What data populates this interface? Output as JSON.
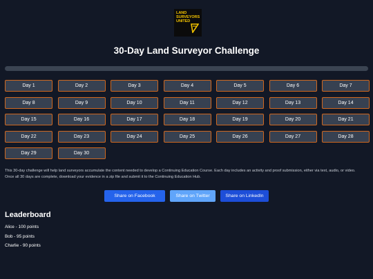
{
  "logo": {
    "text": "LAND\nSURVEYORS\nUNITED"
  },
  "title": "30-Day Land Surveyor Challenge",
  "progress": {
    "completed_fraction": 0.0
  },
  "days": [
    "Day 1",
    "Day 2",
    "Day 3",
    "Day 4",
    "Day 5",
    "Day 6",
    "Day 7",
    "Day 8",
    "Day 9",
    "Day 10",
    "Day 11",
    "Day 12",
    "Day 13",
    "Day 14",
    "Day 15",
    "Day 16",
    "Day 17",
    "Day 18",
    "Day 19",
    "Day 20",
    "Day 21",
    "Day 22",
    "Day 23",
    "Day 24",
    "Day 25",
    "Day 26",
    "Day 27",
    "Day 28",
    "Day 29",
    "Day 30"
  ],
  "description": "This 30-day challenge will help land surveyors accumulate the content needed to develop a Continuing Education Course. Each day includes an activity and proof submission, either via text, audio, or video. Once all 30 days are complete, download your evidence in a zip file and submit it to the Continuing Education Hub.",
  "share": {
    "facebook": "Share on Facebook",
    "twitter": "Share on Twitter",
    "linkedin": "Share on LinkedIn"
  },
  "leaderboard": {
    "title": "Leaderboard",
    "entries": [
      "Alice - 100 points",
      "Bob - 95 points",
      "Charlie - 90 points"
    ]
  },
  "colors": {
    "background": "#121826",
    "day_button_bg": "#374151",
    "day_button_border": "#d0681f",
    "facebook": "#2563eb",
    "twitter": "#60a5fa",
    "linkedin": "#1d4ed8",
    "logo_accent": "#f2c200"
  }
}
